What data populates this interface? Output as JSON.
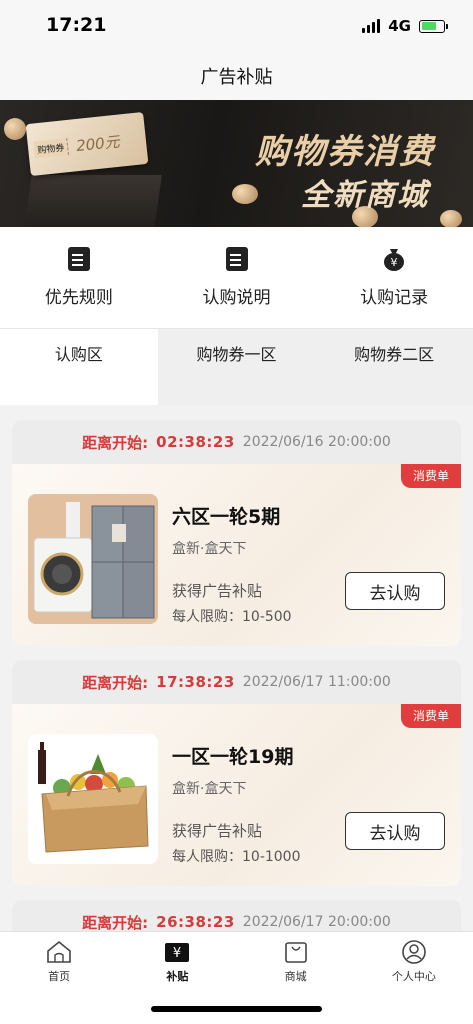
{
  "status": {
    "time": "17:21",
    "network": "4G"
  },
  "nav": {
    "title": "广告补贴"
  },
  "banner": {
    "coupon_tag": "购物券",
    "coupon_amount": "200元",
    "line1": "购物券消费",
    "line2": "全新商城"
  },
  "shortcuts": [
    {
      "label": "优先规则",
      "icon": "document-icon"
    },
    {
      "label": "认购说明",
      "icon": "document-icon"
    },
    {
      "label": "认购记录",
      "icon": "money-bag-icon"
    }
  ],
  "tabs": [
    {
      "label": "认购区",
      "active": true
    },
    {
      "label": "购物券一区",
      "active": false
    },
    {
      "label": "购物券二区",
      "active": false
    }
  ],
  "cards": [
    {
      "countdown_label": "距离开始:",
      "countdown": "02:38:23",
      "date": "2022/06/16 20:00:00",
      "tag": "消费单",
      "title": "六区一轮5期",
      "subtitle": "盒新·盒天下",
      "line1": "获得广告补贴",
      "line2": "每人限购：10-500",
      "button": "去认购",
      "image": "appliances"
    },
    {
      "countdown_label": "距离开始:",
      "countdown": "17:38:23",
      "date": "2022/06/17 11:00:00",
      "tag": "消费单",
      "title": "一区一轮19期",
      "subtitle": "盒新·盒天下",
      "line1": "获得广告补贴",
      "line2": "每人限购：10-1000",
      "button": "去认购",
      "image": "fruit-basket"
    },
    {
      "countdown_label": "距离开始:",
      "countdown": "26:38:23",
      "date": "2022/06/17 20:00:00"
    }
  ],
  "tabbar": [
    {
      "label": "首页",
      "icon": "home-icon",
      "active": false
    },
    {
      "label": "补贴",
      "icon": "subsidy-icon",
      "active": true
    },
    {
      "label": "商城",
      "icon": "shopping-bag-icon",
      "active": false
    },
    {
      "label": "个人中心",
      "icon": "profile-icon",
      "active": false
    }
  ],
  "colors": {
    "accent_red": "#e23d3d",
    "countdown_red": "#d63a3a"
  }
}
